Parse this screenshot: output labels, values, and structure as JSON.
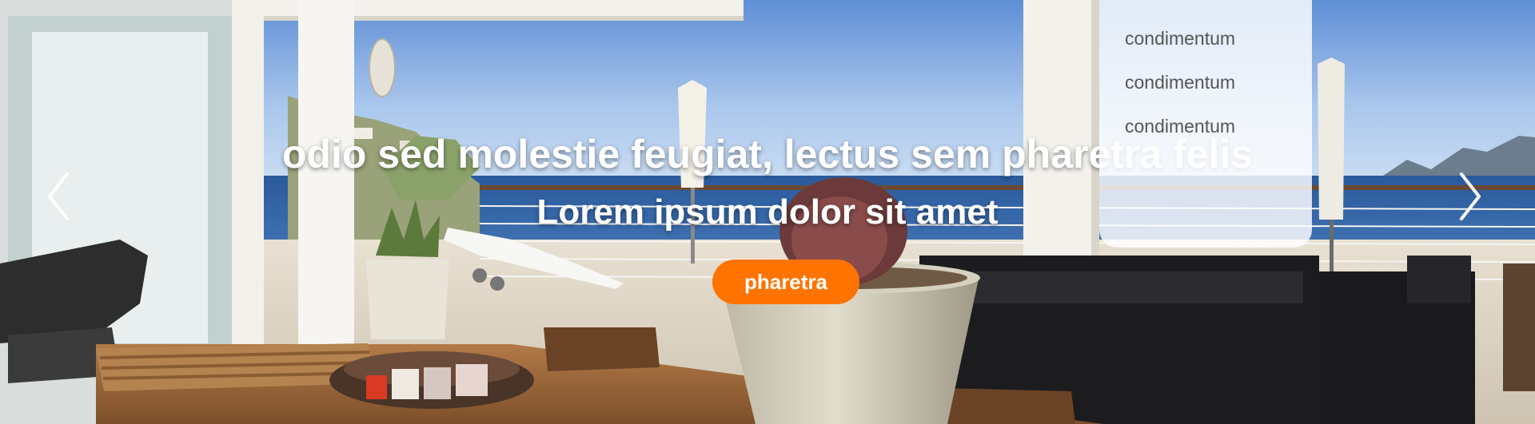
{
  "hero": {
    "title": "odio sed molestie feugiat, lectus sem pharetra felis",
    "subtitle": "Lorem ipsum dolor sit amet",
    "cta_label": "pharetra",
    "cta_color": "#ff7300",
    "prev_icon": "chevron-left-icon",
    "next_icon": "chevron-right-icon",
    "background": "terrace-sea-view-photo"
  },
  "dropdown": {
    "items": [
      {
        "label": "condimentum"
      },
      {
        "label": "condimentum"
      },
      {
        "label": "condimentum"
      }
    ]
  }
}
